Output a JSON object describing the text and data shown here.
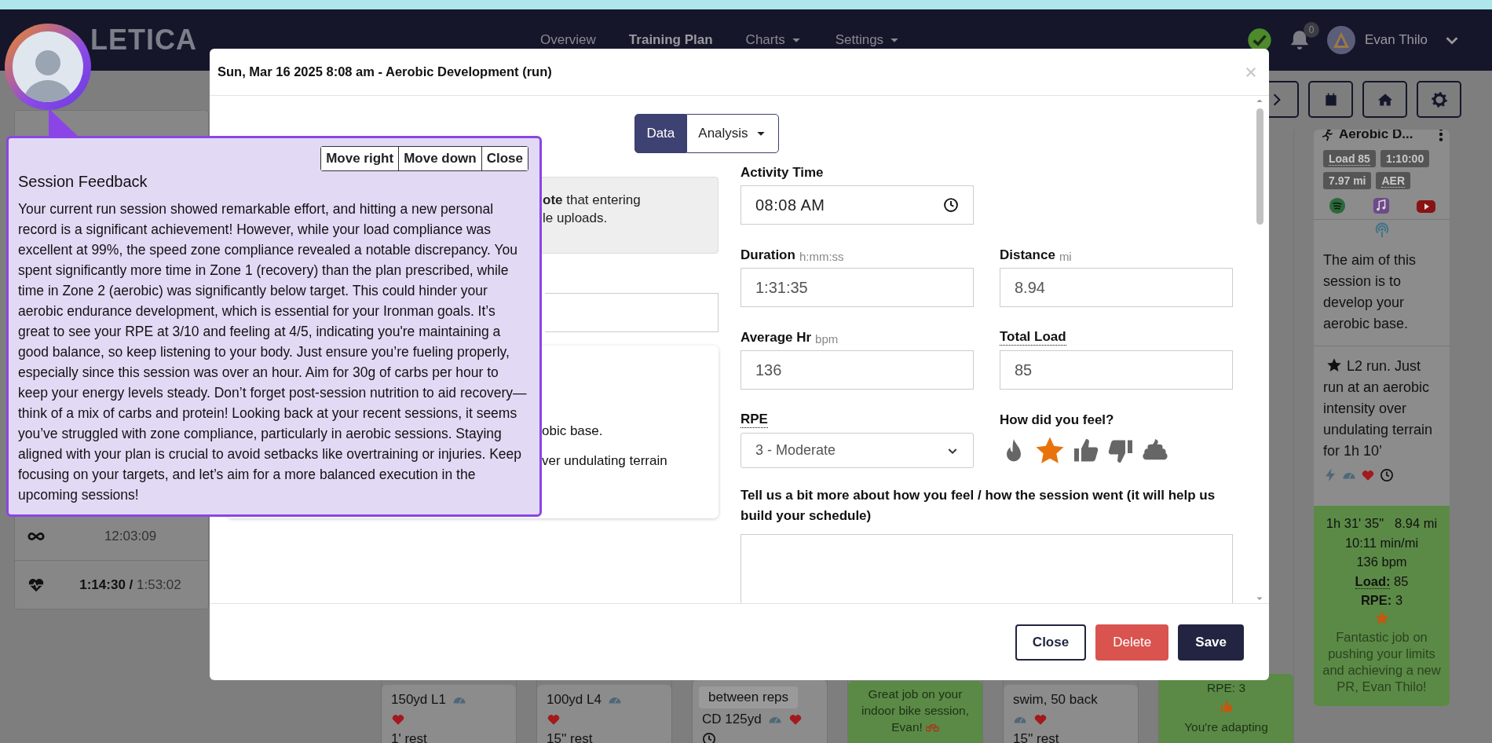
{
  "top_nav": {
    "logo": "LETICA",
    "links": [
      {
        "label": "Overview",
        "selected": false,
        "has_menu": false
      },
      {
        "label": "Training Plan",
        "selected": true,
        "has_menu": false
      },
      {
        "label": "Charts",
        "selected": false,
        "has_menu": true
      },
      {
        "label": "Settings",
        "selected": false,
        "has_menu": true
      }
    ],
    "notification_count": "0",
    "user_name": "Evan Thilo"
  },
  "summary_panel": {
    "rows": [
      {
        "kind": "infinity",
        "primary": null,
        "secondary": "12:03:09"
      },
      {
        "kind": "heart-pulse",
        "primary": "1:14:30 /",
        "secondary": "1:53:02"
      }
    ]
  },
  "toolbar": {
    "buttons": [
      {
        "kind": "next"
      },
      {
        "kind": "calendar"
      },
      {
        "kind": "home"
      },
      {
        "kind": "settings"
      }
    ]
  },
  "day_columns": [
    {
      "kind": "plain",
      "items": [
        {
          "text": "150yd L1",
          "boxed": false,
          "icons": [
            {
              "kind": "gauge"
            }
          ]
        },
        {
          "icons": [
            {
              "kind": "heart"
            }
          ]
        },
        {
          "text": "1' rest",
          "boxed": false
        }
      ]
    },
    {
      "kind": "plain",
      "items": [
        {
          "text": "100yd L4",
          "boxed": false,
          "icons": [
            {
              "kind": "gauge"
            }
          ]
        },
        {
          "icons": [
            {
              "kind": "heart"
            }
          ]
        },
        {
          "text": "15'' rest",
          "boxed": false
        }
      ]
    },
    {
      "kind": "plain",
      "items": [
        {
          "text": "between reps",
          "boxed": true
        },
        {
          "text": "CD 125yd",
          "boxed": false,
          "icons": [
            {
              "kind": "gauge"
            },
            {
              "kind": "heart"
            }
          ]
        },
        {
          "icons": [
            {
              "kind": "clock"
            }
          ]
        }
      ]
    },
    {
      "kind": "completed",
      "items": [
        {
          "text": "Great job on your indoor bike session, Evan!",
          "icons": [
            {
              "kind": "bike"
            }
          ]
        }
      ]
    },
    {
      "kind": "plain",
      "items": [
        {
          "text": "swim, 50 back",
          "boxed": false
        },
        {
          "icons": [
            {
              "kind": "gauge"
            },
            {
              "kind": "heart"
            }
          ]
        },
        {
          "text": "15'' rest",
          "boxed": false
        }
      ]
    },
    {
      "kind": "completed",
      "items": [
        {
          "text": "RPE: 3"
        },
        {
          "icons": [
            {
              "kind": "thumbs-up"
            }
          ]
        },
        {
          "text": "You're adapting"
        }
      ]
    }
  ],
  "session_card": {
    "title": "Aerobic D...",
    "badges": [
      {
        "label": "Load 85",
        "has_tooltip": true
      },
      {
        "label": "1:10:00",
        "has_tooltip": false
      },
      {
        "label": "7.97 mi",
        "has_tooltip": false
      },
      {
        "label": "AER",
        "has_tooltip": true
      }
    ],
    "description": "The aim of this session is to develop your aerobic base.",
    "instruction": "L2 run. Just run at an aerobic intensity over undulating terrain for 1h 10’",
    "result": {
      "duration": "1h 31' 35\"",
      "distance": "8.94 mi",
      "pace": "10:11 min/mi",
      "heart_rate": "136 bpm",
      "stats": [
        {
          "label": "Load:",
          "value": "85",
          "has_tooltip": true
        },
        {
          "label": "RPE:",
          "value": "3",
          "has_tooltip": false
        }
      ],
      "feeling": {
        "kind": "star"
      },
      "comment": "Fantastic job on pushing your limits and achieving a new PR, Evan Thilo!"
    }
  },
  "session_modal": {
    "title": "Sun, Mar 16 2025 8:08 am - Aerobic Development (run)",
    "tabs": [
      {
        "label": "Data",
        "selected": true,
        "has_menu": false
      },
      {
        "label": "Analysis",
        "selected": false,
        "has_menu": true
      }
    ],
    "note_lines": [
      "**ote** that entering",
      "le uploads."
    ],
    "card_lines": [
      "obic base.",
      "ver undulating terrain"
    ],
    "fields": [
      {
        "kind": "time",
        "label": "Activity Time",
        "value": "08:08  AM",
        "has_tooltip": false
      },
      {
        "kind": "text",
        "label": "Duration",
        "unit": "h:mm:ss",
        "value": "1:31:35",
        "has_tooltip": false
      },
      {
        "kind": "text",
        "label": "Distance",
        "unit": "mi",
        "value": "8.94",
        "has_tooltip": false
      },
      {
        "kind": "text",
        "label": "Average Hr",
        "unit": "bpm",
        "value": "136",
        "has_tooltip": false
      },
      {
        "kind": "text",
        "label": "Total Load",
        "value": "85",
        "has_tooltip": true
      },
      {
        "kind": "select",
        "label": "RPE",
        "value": "3 - Moderate",
        "has_tooltip": true
      },
      {
        "kind": "rating",
        "label": "How did you feel?",
        "has_tooltip": false,
        "options": [
          {
            "kind": "flame",
            "selected": false
          },
          {
            "kind": "star",
            "selected": true
          },
          {
            "kind": "thumbs-up",
            "selected": false
          },
          {
            "kind": "thumbs-down",
            "selected": false
          },
          {
            "kind": "poop",
            "selected": false
          }
        ]
      },
      {
        "kind": "textarea",
        "label": "Tell us a bit more about how you feel / how the session went (it will help us build your schedule)",
        "has_tooltip": false
      }
    ],
    "buttons": [
      {
        "kind": "close",
        "label": "Close"
      },
      {
        "kind": "delete",
        "label": "Delete"
      },
      {
        "kind": "save",
        "label": "Save"
      }
    ]
  },
  "feedback_popup": {
    "title": "Session Feedback",
    "buttons": [
      "Move right",
      "Move down",
      "Close"
    ],
    "text": "Your current run session showed remarkable effort, and hitting a new personal record is a significant achievement! However, while your load compliance was excellent at 99%, the speed zone compliance revealed a notable discrepancy. You spent significantly more time in Zone 1 (recovery) than the plan prescribed, while time in Zone 2 (aerobic) was significantly below target. This could hinder your aerobic endurance development, which is essential for your Ironman goals. It’s great to see your RPE at 3/10 and feeling at 4/5, indicating you're maintaining a good balance, so keep listening to your body. Just ensure you’re fueling properly, especially since this session was over an hour. Aim for 30g of carbs per hour to keep your energy levels steady. Don’t forget post-session nutrition to aid recovery—think of a mix of carbs and protein! Looking back at your recent sessions, it seems you’ve struggled with zone compliance, particularly in aerobic sessions. Staying aligned with your plan is crucial to avoid setbacks like overtraining or injuries. Keep focusing on your targets, and let’s aim for a more balanced execution in the upcoming sessions!"
  }
}
